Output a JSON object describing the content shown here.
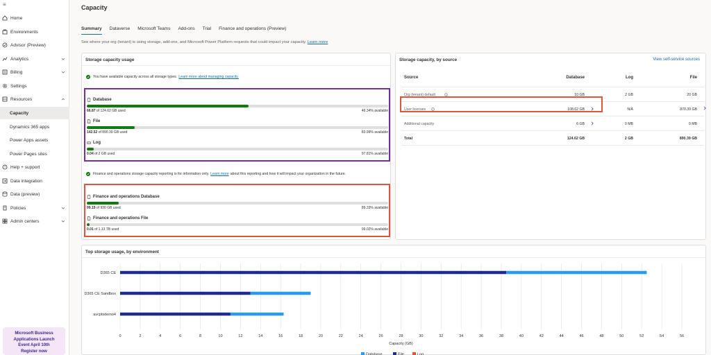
{
  "sidebar": {
    "items": [
      {
        "label": "Home",
        "icon": "home-icon"
      },
      {
        "label": "Environments",
        "icon": "environments-icon"
      },
      {
        "label": "Advisor (Preview)",
        "icon": "advisor-icon"
      },
      {
        "label": "Analytics",
        "icon": "analytics-icon"
      },
      {
        "label": "Billing",
        "icon": "billing-icon"
      },
      {
        "label": "Settings",
        "icon": "gear-icon"
      },
      {
        "label": "Resources",
        "icon": "resources-icon"
      },
      {
        "label": "Capacity",
        "icon": ""
      },
      {
        "label": "Dynamics 365 apps",
        "icon": ""
      },
      {
        "label": "Power Apps assets",
        "icon": ""
      },
      {
        "label": "Power Pages sites",
        "icon": ""
      },
      {
        "label": "Help + support",
        "icon": "help-icon"
      },
      {
        "label": "Data integration",
        "icon": "data-integration-icon"
      },
      {
        "label": "Data (preview)",
        "icon": "data-icon"
      },
      {
        "label": "Policies",
        "icon": "policies-icon"
      },
      {
        "label": "Admin centers",
        "icon": "admin-centers-icon"
      }
    ],
    "promo": {
      "line1": "Microsoft Business",
      "line2": "Applications Launch",
      "line3": "Event April 10th",
      "line4": "Register now"
    }
  },
  "page": {
    "title": "Capacity",
    "tabs": [
      "Summary",
      "Dataverse",
      "Microsoft Teams",
      "Add-ons",
      "Trial",
      "Finance and operations (Preview)"
    ],
    "description": "See where your org (tenant) is using storage, add-ons, and Microsoft Power Platform requests that could impact your capacity.",
    "description_link": "Learn more"
  },
  "storage_usage": {
    "title": "Storage capacity usage",
    "status_text": "You have available capacity across all storage types.",
    "status_link": "Learn more about managing capacity.",
    "items": [
      {
        "name": "Database",
        "used": "66.87",
        "used_suffix": "of 124.62 GB used",
        "available": "46.34% available",
        "fill": 0.537
      },
      {
        "name": "File",
        "used": "142.52",
        "used_suffix": "of 890.39 GB used",
        "available": "83.99% available",
        "fill": 0.16
      },
      {
        "name": "Log",
        "used": "0.04",
        "used_suffix": "of 2 GB used",
        "available": "97.81% available",
        "fill": 0.022
      }
    ],
    "fo_text_before": "Finance and operations storage capacity reporting is for information only.",
    "fo_link": "Learn more",
    "fo_text_after": "about this reporting and how it will impact your organization in the future.",
    "fo_items": [
      {
        "name": "Finance and operations Database",
        "used": "99.19",
        "used_suffix": "of 930 GB used",
        "available": "89.33% available",
        "fill": 0.107
      },
      {
        "name": "Finance and operations File",
        "used": "0.01",
        "used_suffix": "of 1.13 TB used",
        "available": "99.02% available",
        "fill": 0.01
      }
    ]
  },
  "by_source": {
    "title": "Storage capacity, by source",
    "link": "View self-service sources",
    "headers": [
      "Source",
      "Database",
      "Log",
      "File"
    ],
    "rows": [
      {
        "source": "Org (tenant) default",
        "database": "10 GB",
        "log": "2 GB",
        "file": "20 GB",
        "info": true,
        "chevron": false
      },
      {
        "source": "User licenses",
        "database": "108.62 GB",
        "log": "N/A",
        "file": "870.39 GB",
        "info": true,
        "chevron": true
      },
      {
        "source": "Additional capacity",
        "database": "6 GB",
        "log": "0 MB",
        "file": "0 MB",
        "info": false,
        "chevron": true
      },
      {
        "source": "Total",
        "database": "124.62 GB",
        "log": "2 GB",
        "file": "890.39 GB",
        "info": false,
        "chevron": false
      }
    ]
  },
  "top_usage": {
    "title": "Top storage usage, by environment"
  },
  "colors": {
    "database": "#2899f5",
    "file": "#1e2a8c",
    "log": "#e0533e",
    "purple_highlight": "#7030a0",
    "red_highlight": "#e0533e"
  },
  "chart_data": {
    "type": "bar",
    "orientation": "horizontal",
    "stacked": true,
    "categories": [
      "D365 CE",
      "D365 CE Sandbox",
      "avcptsdemo4"
    ],
    "series": [
      {
        "name": "File",
        "color": "#1e2a8c",
        "values": [
          38.5,
          13,
          11
        ]
      },
      {
        "name": "Database",
        "color": "#2899f5",
        "values": [
          14,
          6,
          5.3
        ]
      },
      {
        "name": "Log",
        "color": "#e0533e",
        "values": [
          0,
          0,
          0
        ]
      }
    ],
    "xlabel": "Capacity (GB)",
    "xlim": [
      0,
      56
    ],
    "xticks": [
      0,
      2,
      4,
      6,
      8,
      10,
      12,
      14,
      16,
      18,
      20,
      22,
      24,
      26,
      28,
      30,
      32,
      34,
      36,
      38,
      40,
      42,
      44,
      46,
      48,
      50,
      52,
      54,
      56
    ],
    "legend": [
      "Database",
      "File",
      "Log"
    ],
    "legend_position": "bottom",
    "grid": true
  }
}
